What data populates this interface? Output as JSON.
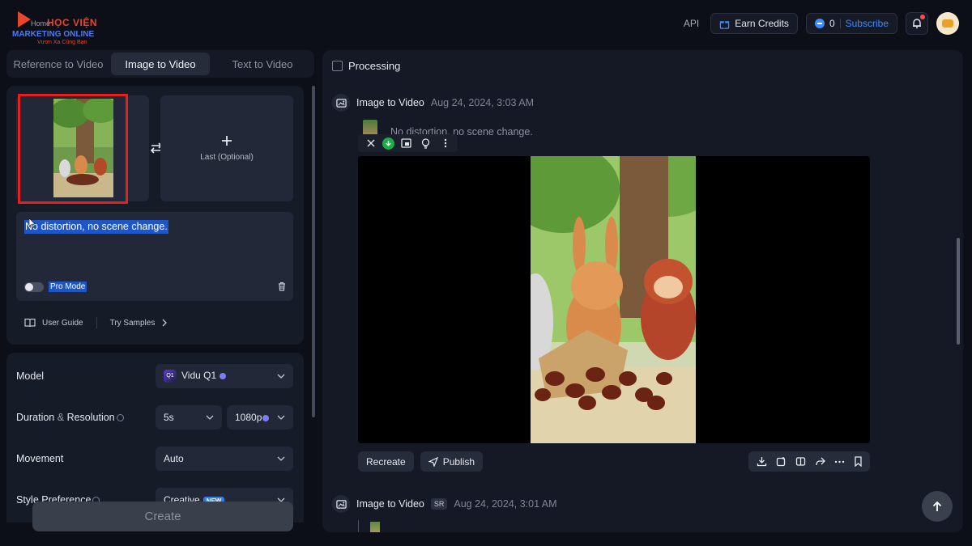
{
  "logo": {
    "home": "Home",
    "line1": "HỌC VIỆN",
    "line2": "MARKETING ONLINE",
    "line3": "Vươn Xa Cùng Bạn"
  },
  "topbar": {
    "api": "API",
    "earn_credits": "Earn Credits",
    "credits": "0",
    "subscribe": "Subscribe"
  },
  "tabs": [
    {
      "label": "Reference to Video",
      "active": false
    },
    {
      "label": "Image to Video",
      "active": true
    },
    {
      "label": "Text to Video",
      "active": false
    }
  ],
  "upload": {
    "last_label": "Last (Optional)",
    "prompt": "No distortion, no scene change.",
    "pro_mode": "Pro Mode",
    "user_guide": "User Guide",
    "try_samples": "Try Samples"
  },
  "settings": {
    "model_label": "Model",
    "model_value": "Vidu Q1",
    "model_icon_text": "Q1",
    "duration_label": "Duration",
    "duration_amp": "&",
    "resolution_label": "Resolution",
    "duration_value": "5s",
    "resolution_value": "1080p",
    "movement_label": "Movement",
    "movement_value": "Auto",
    "style_label": "Style Preference",
    "style_value": "Creative",
    "style_badge": "NEW",
    "create": "Create"
  },
  "results": {
    "processing": "Processing",
    "tasks": [
      {
        "title": "Image to Video",
        "badge": "",
        "date": "Aug 24, 2024, 3:03 AM",
        "prompt": "No distortion, no scene change."
      },
      {
        "title": "Image to Video",
        "badge": "SR",
        "date": "Aug 24, 2024, 3:01 AM"
      }
    ],
    "recreate": "Recreate",
    "publish": "Publish"
  },
  "colors": {
    "accent": "#3d8cff",
    "highlight": "#1e56c7",
    "annotation_frame": "#e3201e",
    "success": "#1faa4b"
  }
}
